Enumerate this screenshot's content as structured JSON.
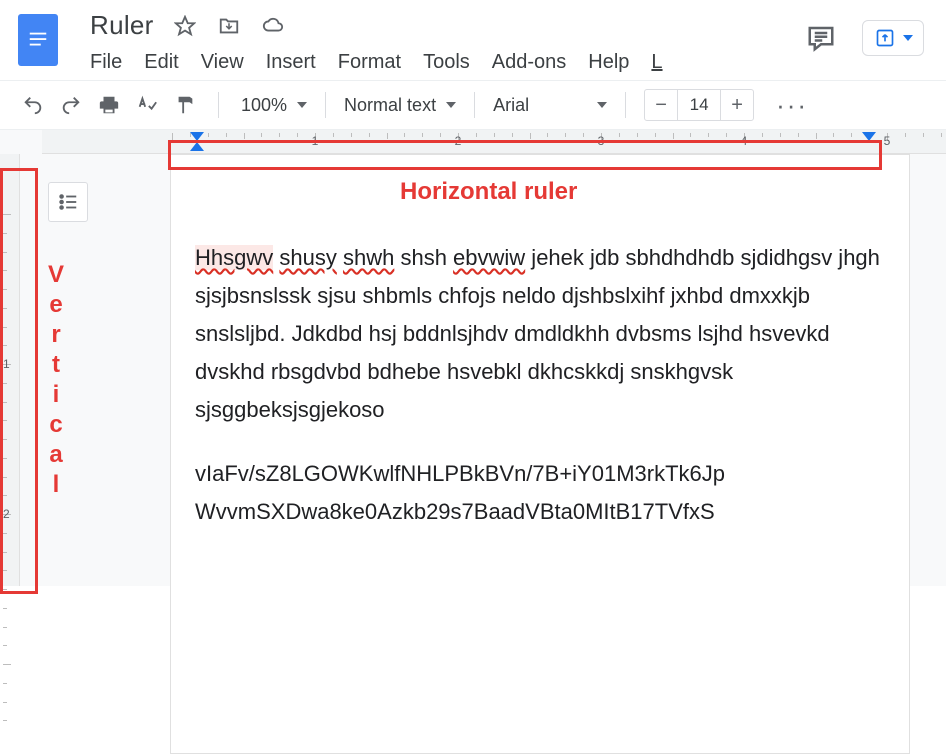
{
  "doc": {
    "title": "Ruler"
  },
  "menus": {
    "file": "File",
    "edit": "Edit",
    "view": "View",
    "insert": "Insert",
    "format": "Format",
    "tools": "Tools",
    "addons": "Add-ons",
    "help": "Help",
    "last": "L"
  },
  "toolbar": {
    "zoom": "100%",
    "style": "Normal text",
    "font": "Arial",
    "size": "14",
    "minus": "−",
    "plus": "+",
    "more": "···"
  },
  "ruler": {
    "h_labels": [
      "1",
      "2",
      "3",
      "4",
      "5"
    ],
    "v_labels": [
      "1",
      "2"
    ]
  },
  "annotations": {
    "h": "Horizontal ruler",
    "v": [
      "V",
      "e",
      "r",
      "t",
      "i",
      "c",
      "a",
      "l"
    ]
  },
  "body": {
    "p1_word": "Hhsgwv",
    "p1_rest_a": " ",
    "p1_err1": "shusy",
    "p1_gap1": " ",
    "p1_err2": "shwh",
    "p1_gap2": " shsh ",
    "p1_err3": "ebvwiw",
    "p1_rest_b": " jehek jdb sbhdhdhdb sjdidhgsv jhgh sjsjbsnslssk sjsu shbmls chfojs neldo djshbslxihf jxhbd dmxxkjb snslsljbd. Jdkdbd hsj bddnlsjhdv dmdldkhh dvbsms lsjhd hsvevkd dvskhd rbsgdvbd bdhebe hsvebkl dkhcskkdj snskhgvsk sjsggbeksjsgjekoso",
    "p2": "vIaFv/sZ8LGOWKwlfNHLPBkBVn/7B+iY01M3rkTk6Jp WvvmSXDwa8ke0Azkb29s7BaadVBta0MItB17TVfxS"
  }
}
